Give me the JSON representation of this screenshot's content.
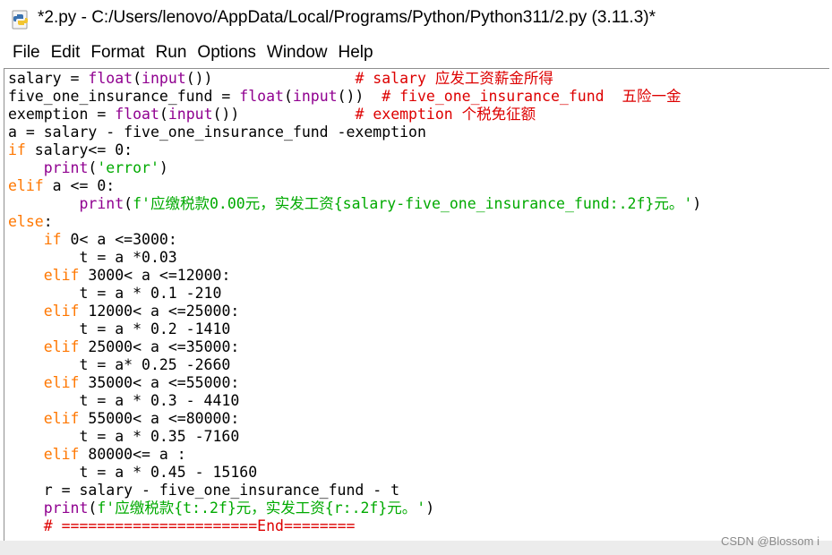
{
  "window": {
    "title": "*2.py - C:/Users/lenovo/AppData/Local/Programs/Python/Python311/2.py (3.11.3)*",
    "icon": "python-file-icon"
  },
  "menu": {
    "items": [
      "File",
      "Edit",
      "Format",
      "Run",
      "Options",
      "Window",
      "Help"
    ]
  },
  "code": {
    "lines": [
      "salary = float(input())                # salary 应发工资薪金所得",
      "five_one_insurance_fund = float(input())  # five_one_insurance_fund  五险一金",
      "exemption = float(input())             # exemption 个税免征额",
      "a = salary - five_one_insurance_fund -exemption",
      "if salary<= 0:",
      "    print('error')",
      "elif a <= 0:",
      "        print(f'应缴税款0.00元，实发工资{salary-five_one_insurance_fund:.2f}元。')",
      "else:",
      "    if 0< a <=3000:",
      "        t = a *0.03",
      "    elif 3000< a <=12000:",
      "        t = a * 0.1 -210",
      "    elif 12000< a <=25000:",
      "        t = a * 0.2 -1410",
      "    elif 25000< a <=35000:",
      "        t = a* 0.25 -2660",
      "    elif 35000< a <=55000:",
      "        t = a * 0.3 - 4410",
      "    elif 55000< a <=80000:",
      "        t = a * 0.35 -7160",
      "    elif 80000<= a :",
      "        t = a * 0.45 - 15160",
      "    r = salary - five_one_insurance_fund - t",
      "    print(f'应缴税款{t:.2f}元，实发工资{r:.2f}元。')",
      "    # ======================End========"
    ]
  },
  "colors": {
    "keyword": "#ff7700",
    "builtin": "#900090",
    "string": "#00aa00",
    "comment": "#dd0000"
  },
  "watermark": "CSDN @Blossom i"
}
